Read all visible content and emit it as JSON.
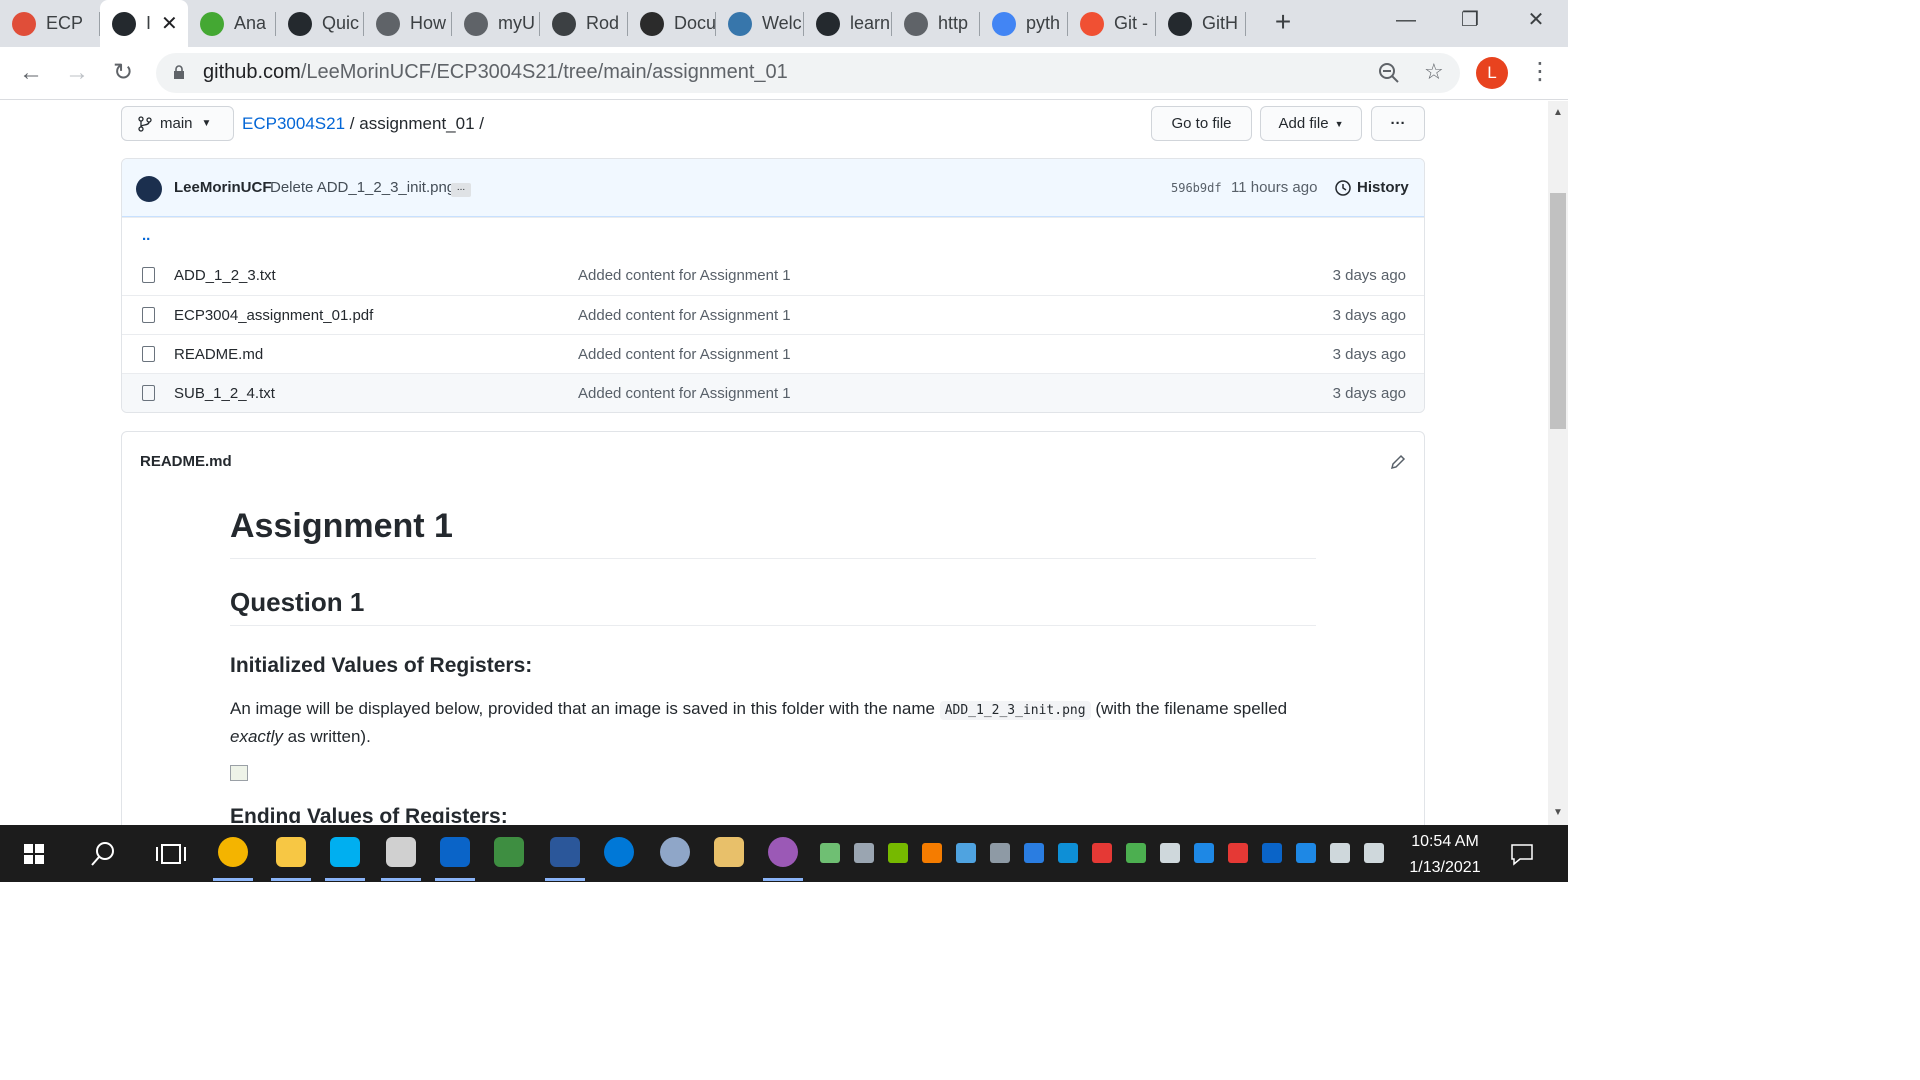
{
  "browser": {
    "tabs": [
      {
        "label": "ECP",
        "icon": "ucf-icon",
        "color": "#e04e39"
      },
      {
        "label": "I",
        "icon": "github-icon",
        "color": "#24292e",
        "active": true
      },
      {
        "label": "Ana",
        "icon": "anaconda-icon",
        "color": "#44a833"
      },
      {
        "label": "Quic",
        "icon": "github-icon",
        "color": "#24292e"
      },
      {
        "label": "How",
        "icon": "wheel-icon",
        "color": "#5f6368"
      },
      {
        "label": "myU",
        "icon": "globe-icon",
        "color": "#5f6368"
      },
      {
        "label": "Rod",
        "icon": "laptop-icon",
        "color": "#3c4043"
      },
      {
        "label": "Docu",
        "icon": "doc-icon",
        "color": "#2b2b2b"
      },
      {
        "label": "Welc",
        "icon": "python-icon",
        "color": "#3776ab"
      },
      {
        "label": "learn",
        "icon": "github-icon",
        "color": "#24292e"
      },
      {
        "label": "http",
        "icon": "globe-icon",
        "color": "#5f6368"
      },
      {
        "label": "pyth",
        "icon": "google-icon",
        "color": "#4285f4"
      },
      {
        "label": "Git -",
        "icon": "git-icon",
        "color": "#f05033"
      },
      {
        "label": "GitH",
        "icon": "github-icon",
        "color": "#24292e"
      }
    ],
    "url_host": "github.com",
    "url_path": "/LeeMorinUCF/ECP3004S21/tree/main/assignment_01",
    "profile_initial": "L"
  },
  "repo": {
    "branch": "main",
    "breadcrumb_repo": "ECP3004S21",
    "breadcrumb_sep": "/",
    "breadcrumb_dir": "assignment_01",
    "go_to_file": "Go to file",
    "add_file": "Add file",
    "more": "···"
  },
  "commit": {
    "author": "LeeMorinUCF",
    "message": "Delete ADD_1_2_3_init.png",
    "ellipsis": "...",
    "sha": "596b9df",
    "age": "11 hours ago",
    "history": "History"
  },
  "files": {
    "parent": "..",
    "rows": [
      {
        "name": "ADD_1_2_3.txt",
        "message": "Added content for Assignment 1",
        "age": "3 days ago"
      },
      {
        "name": "ECP3004_assignment_01.pdf",
        "message": "Added content for Assignment 1",
        "age": "3 days ago"
      },
      {
        "name": "README.md",
        "message": "Added content for Assignment 1",
        "age": "3 days ago"
      },
      {
        "name": "SUB_1_2_4.txt",
        "message": "Added content for Assignment 1",
        "age": "3 days ago"
      }
    ]
  },
  "readme": {
    "filename": "README.md",
    "h1": "Assignment 1",
    "h2": "Question 1",
    "h3": "Initialized Values of Registers:",
    "p_before": "An image will be displayed below, provided that an image is saved in this folder with the name",
    "p_code": "ADD_1_2_3_init.png",
    "p_after": "(with the filename spelled",
    "p_em": "exactly",
    "p_end": "as written).",
    "next_heading": "Ending Values of Registers:"
  },
  "taskbar": {
    "time": "10:54 AM",
    "date": "1/13/2021"
  },
  "colors": {
    "accent": "#0366d6",
    "commit_bg": "#f1f8ff",
    "taskbar": "#1c1c1c",
    "profile": "#e8431f"
  }
}
